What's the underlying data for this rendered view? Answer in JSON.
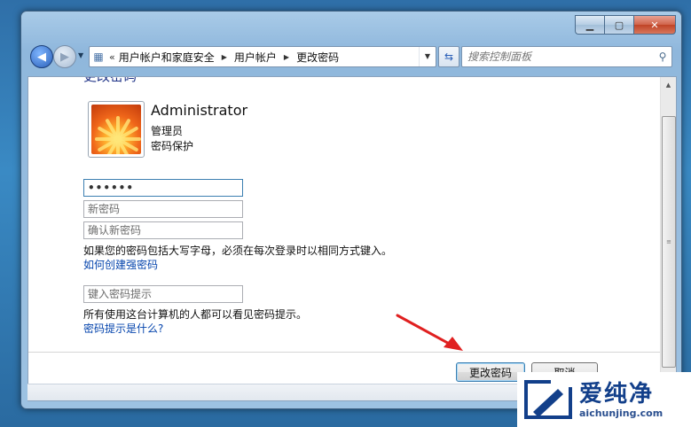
{
  "window": {
    "minimize_icon": "minimize-icon",
    "maximize_icon": "maximize-icon",
    "close_icon": "close-icon"
  },
  "navbar": {
    "breadcrumbs": [
      "用户帐户和家庭安全",
      "用户帐户",
      "更改密码"
    ],
    "search_placeholder": "搜索控制面板"
  },
  "page": {
    "title": "更改密码",
    "user": {
      "name": "Administrator",
      "role": "管理员",
      "status": "密码保护"
    },
    "fields": {
      "current_password_value": "••••••",
      "new_password_placeholder": "新密码",
      "confirm_password_placeholder": "确认新密码",
      "hint_placeholder": "键入密码提示"
    },
    "case_note": "如果您的密码包括大写字母，必须在每次登录时以相同方式键入。",
    "strong_password_link": "如何创建强密码",
    "hint_note": "所有使用这台计算机的人都可以看见密码提示。",
    "hint_link": "密码提示是什么?",
    "buttons": {
      "change": "更改密码",
      "cancel": "取消"
    }
  },
  "watermark": {
    "cn": "爱纯净",
    "en": "aichunjing.com"
  },
  "colors": {
    "link": "#0645ad",
    "title": "#1e3287",
    "arrow": "#e02020"
  }
}
